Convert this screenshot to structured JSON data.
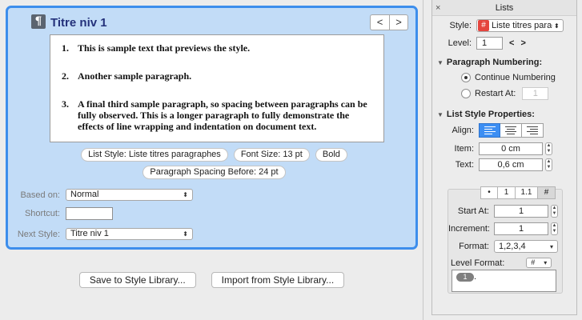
{
  "style": {
    "name": "Titre niv 1",
    "nav_prev": "<",
    "nav_next": ">",
    "preview_items": [
      {
        "num": "1.",
        "text": "This is sample text that previews the style."
      },
      {
        "num": "2.",
        "text": "Another sample paragraph."
      },
      {
        "num": "3.",
        "text": "A final third sample paragraph, so spacing between paragraphs can be fully observed. This is a longer paragraph to fully demonstrate the effects of line wrapping and indentation on document text."
      }
    ],
    "chips": {
      "list_style": "List Style: Liste titres paragraphes",
      "font_size": "Font Size: 13 pt",
      "bold": "Bold",
      "para_spacing": "Paragraph Spacing Before: 24 pt"
    },
    "based_on_label": "Based on:",
    "based_on_value": "Normal",
    "shortcut_label": "Shortcut:",
    "shortcut_value": "",
    "next_style_label": "Next Style:",
    "next_style_value": "Titre niv 1"
  },
  "buttons": {
    "save": "Save to Style Library...",
    "import": "Import from Style Library..."
  },
  "panel": {
    "title": "Lists",
    "close": "×",
    "style_label": "Style:",
    "style_badge": "#",
    "style_value": "Liste titres paragraphes",
    "level_label": "Level:",
    "level_value": "1",
    "level_prev": "<",
    "level_next": ">",
    "numbering_header": "Paragraph Numbering:",
    "continue_label": "Continue Numbering",
    "restart_label": "Restart At:",
    "restart_value": "1",
    "props_header": "List Style Properties:",
    "align_label": "Align:",
    "item_label": "Item:",
    "item_value": "0 cm",
    "text_label": "Text:",
    "text_value": "0,6 cm",
    "tabs": [
      "•",
      "1",
      "1.1",
      "#"
    ],
    "start_label": "Start At:",
    "start_value": "1",
    "increment_label": "Increment:",
    "increment_value": "1",
    "format_label": "Format:",
    "format_value": "1,2,3,4",
    "level_format_label": "Level Format:",
    "level_format_menu": "#",
    "token_value": "1",
    "token_suffix": "."
  }
}
